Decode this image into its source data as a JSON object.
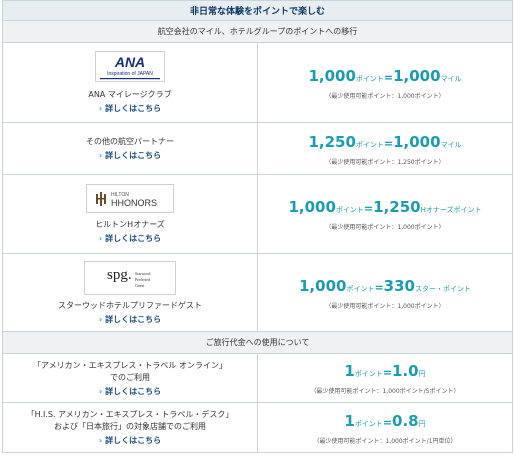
{
  "header": {
    "title": "非日常な体験をポイントで楽しむ"
  },
  "section1": {
    "title": "航空会社のマイル、ホテルグループのポイントへの移行",
    "rows": [
      {
        "name": "ANA マイレージクラブ",
        "link": "詳しくはこちら",
        "logo": {
          "brand": "ANA",
          "sub": "Inspiration of JAPAN"
        },
        "num1": "1,000",
        "unit1": "ポイント",
        "eq": "=",
        "num2": "1,000",
        "unit2": "マイル",
        "note": "（最少使用可能ポイント：1,000ポイント）"
      },
      {
        "name": "その他の航空パートナー",
        "link": "詳しくはこちら",
        "num1": "1,250",
        "unit1": "ポイント",
        "eq": "=",
        "num2": "1,000",
        "unit2": "マイル",
        "note": "（最少使用可能ポイント：1,250ポイント）"
      },
      {
        "name": "ヒルトンHオナーズ",
        "link": "詳しくはこちら",
        "logo": {
          "line1": "HILTON",
          "line2": "HHONORS"
        },
        "num1": "1,000",
        "unit1": "ポイント",
        "eq": "=",
        "num2": "1,250",
        "unit2": "Hオナーズポイント",
        "note": "（最少使用可能ポイント：1,000ポイント）"
      },
      {
        "name": "スターウッドホテルプリファードゲスト",
        "link": "詳しくはこちら",
        "logo": {
          "brand": "spg.",
          "sub1": "Starwood",
          "sub2": "Preferred",
          "sub3": "Guest"
        },
        "num1": "1,000",
        "unit1": "ポイント",
        "eq": "=",
        "num2": "330",
        "unit2": "スター・ポイント",
        "note": "（最少使用可能ポイント：1,000ポイント）"
      }
    ]
  },
  "section2": {
    "title": "ご旅行代金への使用について",
    "rows": [
      {
        "line1": "「アメリカン・エキスプレス・トラベル オンライン」",
        "line2": "でのご利用",
        "link": "詳しくはこちら",
        "num1": "1",
        "unit1": "ポイント",
        "eq": "=",
        "num2": "1.0",
        "unit2": "円",
        "note": "（最少使用可能ポイント：1,000ポイント/5ポイント）"
      },
      {
        "line1": "「H.I.S. アメリカン・エキスプレス・トラベル・デスク」",
        "line2": "および「日本旅行」の対象店舗でのご利用",
        "link": "詳しくはこちら",
        "num1": "1",
        "unit1": "ポイント",
        "eq": "=",
        "num2": "0.8",
        "unit2": "円",
        "note": "（最少使用可能ポイント：1,000ポイント/1円単位）"
      }
    ]
  },
  "colors": {
    "accent": "#1a9cb0",
    "header_text": "#0b3a66",
    "link": "#1a4c7a",
    "border": "#c9d3da"
  }
}
